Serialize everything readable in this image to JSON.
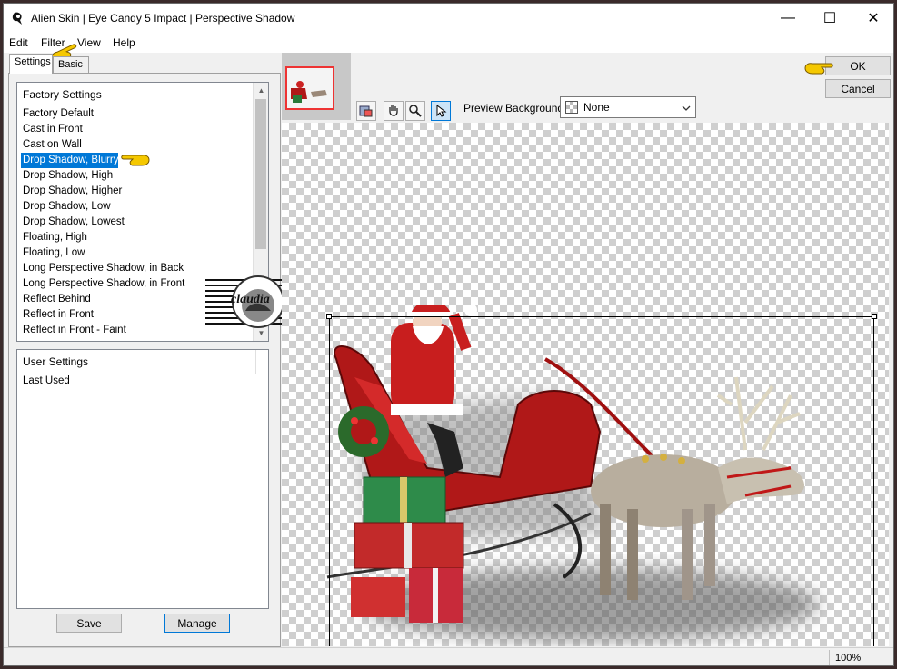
{
  "window": {
    "title": "Alien Skin | Eye Candy 5 Impact | Perspective Shadow",
    "min_glyph": "—",
    "max_glyph": "☐",
    "close_glyph": "✕"
  },
  "menu": [
    "Edit",
    "Filter",
    "View",
    "Help"
  ],
  "tabs": {
    "settings": "Settings",
    "basic": "Basic"
  },
  "factory_settings": {
    "header": "Factory Settings",
    "items": [
      "Factory Default",
      "Cast in Front",
      "Cast on Wall",
      "Drop Shadow, Blurry",
      "Drop Shadow, High",
      "Drop Shadow, Higher",
      "Drop Shadow, Low",
      "Drop Shadow, Lowest",
      "Floating, High",
      "Floating, Low",
      "Long Perspective Shadow, in Back",
      "Long Perspective Shadow, in Front",
      "Reflect Behind",
      "Reflect in Front",
      "Reflect in Front - Faint"
    ],
    "selected_index": 3
  },
  "user_settings": {
    "header": "User Settings",
    "items": [
      "Last Used"
    ]
  },
  "buttons": {
    "save": "Save",
    "manage": "Manage",
    "ok": "OK",
    "cancel": "Cancel"
  },
  "preview": {
    "background_label": "Preview Background:",
    "background_value": "None"
  },
  "watermark_text": "claudia",
  "status": {
    "zoom": "100%"
  },
  "colors": {
    "selection": "#0078d7",
    "navigator_frame": "#ee3333",
    "pointer": "#f5c800"
  },
  "icons": [
    "app-icon",
    "navigator-tool-icon",
    "hand-tool-icon",
    "zoom-tool-icon",
    "pointer-tool-icon",
    "chevron-down-icon",
    "yellow-hand-pointer-icon"
  ]
}
